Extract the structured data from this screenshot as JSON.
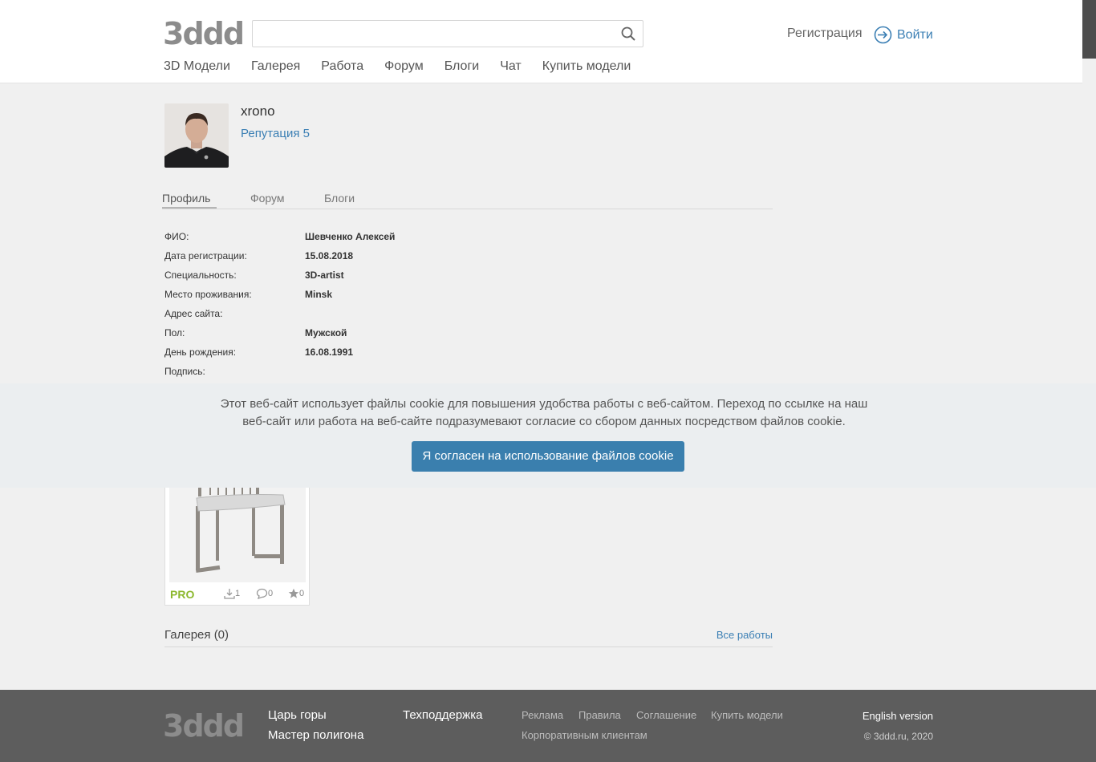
{
  "header": {
    "logo": "3ddd",
    "search": {
      "value": "",
      "placeholder": ""
    },
    "nav": [
      "3D Модели",
      "Галерея",
      "Работа",
      "Форум",
      "Блоги",
      "Чат",
      "Купить модели"
    ],
    "register": "Регистрация",
    "login": "Войти"
  },
  "profile": {
    "username": "xrono",
    "reputation": "Репутация 5",
    "tabs": [
      "Профиль",
      "Форум",
      "Блоги"
    ],
    "active_tab": "Профиль",
    "fields": [
      {
        "label": "ФИО:",
        "value": "Шевченко Алексей"
      },
      {
        "label": "Дата регистрации:",
        "value": "15.08.2018"
      },
      {
        "label": "Специальность:",
        "value": "3D-artist"
      },
      {
        "label": "Место проживания:",
        "value": "Minsk"
      },
      {
        "label": "Адрес сайта:",
        "value": ""
      },
      {
        "label": "Пол:",
        "value": "Мужской"
      },
      {
        "label": "День рождения:",
        "value": "16.08.1991"
      },
      {
        "label": "Подпись:",
        "value": ""
      }
    ]
  },
  "model_card": {
    "badge": "PRO",
    "downloads": "1",
    "comments": "0",
    "favorites": "0"
  },
  "gallery": {
    "title": "Галерея (0)",
    "all_works": "Все работы"
  },
  "cookie": {
    "text": "Этот веб-сайт использует файлы cookie для повышения удобства работы с веб-сайтом. Переход по ссылке на наш веб-сайт или работа на веб-сайте подразумевают согласие со сбором данных посредством файлов cookie.",
    "button": "Я согласен на использование файлов cookie"
  },
  "footer": {
    "logo": "3ddd",
    "col1": [
      "Царь горы",
      "Мастер полигона"
    ],
    "col2": [
      "Техподдержка"
    ],
    "links_row1": [
      "Реклама",
      "Правила",
      "Соглашение",
      "Купить модели"
    ],
    "links_row2": [
      "Корпоративным клиентам"
    ],
    "english": "English version",
    "copyright": "© 3ddd.ru, 2020"
  },
  "colors": {
    "accent": "#3a7fae",
    "link": "#3b7fb4",
    "pro": "#8cb82e",
    "footer_bg": "#5d5d5d"
  }
}
